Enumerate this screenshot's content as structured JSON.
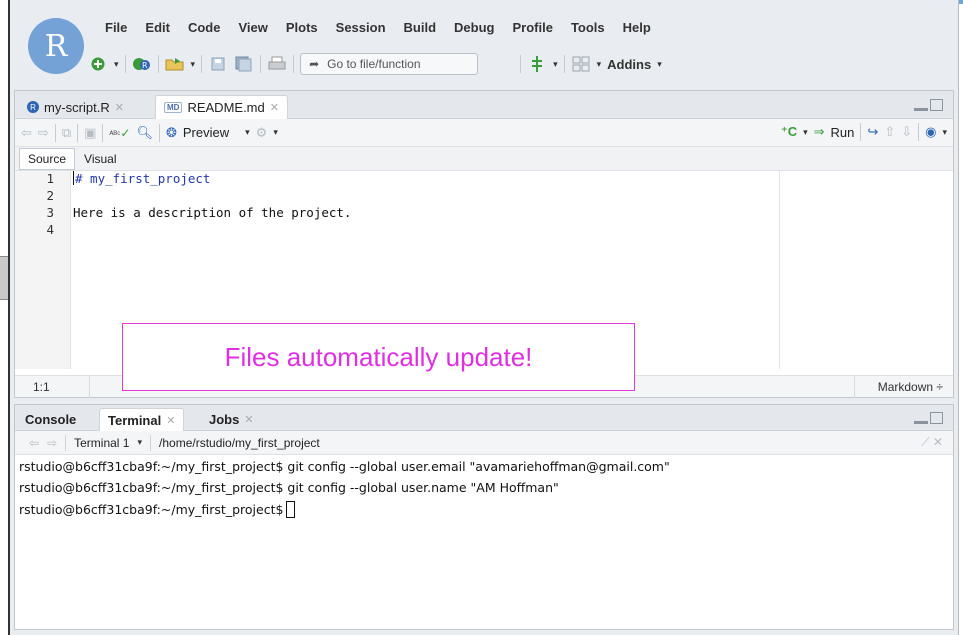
{
  "app": {
    "logo_letter": "R",
    "accent": "#74a2d7"
  },
  "menu": [
    "File",
    "Edit",
    "Code",
    "View",
    "Plots",
    "Session",
    "Build",
    "Debug",
    "Profile",
    "Tools",
    "Help"
  ],
  "toolbar": {
    "goto_placeholder": "Go to file/function",
    "addins_label": "Addins"
  },
  "source": {
    "tabs": [
      {
        "label": "my-script.R",
        "icon": "r-file-icon",
        "active": false
      },
      {
        "label": "README.md",
        "icon": "md-file-icon",
        "active": true
      }
    ],
    "preview_label": "Preview",
    "run_label": "Run",
    "modes": [
      "Source",
      "Visual"
    ],
    "lines": [
      {
        "num": "1",
        "text": "# my_first_project"
      },
      {
        "num": "2",
        "text": ""
      },
      {
        "num": "3",
        "text": "Here is a description of the project."
      },
      {
        "num": "4",
        "text": ""
      }
    ],
    "cursor_position": "1:1",
    "language": "Markdown ÷"
  },
  "console": {
    "tabs": [
      {
        "label": "Console",
        "closable": false
      },
      {
        "label": "Terminal",
        "closable": true,
        "active": true
      },
      {
        "label": "Jobs",
        "closable": true
      }
    ],
    "terminal_selector": "Terminal 1",
    "path": "/home/rstudio/my_first_project",
    "lines": [
      "rstudio@b6cff31cba9f:~/my_first_project$ git config --global user.email \"avamariehoffman@gmail.com\"",
      "rstudio@b6cff31cba9f:~/my_first_project$ git config --global user.name \"AM Hoffman\"",
      "rstudio@b6cff31cba9f:~/my_first_project$"
    ]
  },
  "annotation": {
    "text": "Files automatically update!",
    "color": "#e02fe0"
  }
}
